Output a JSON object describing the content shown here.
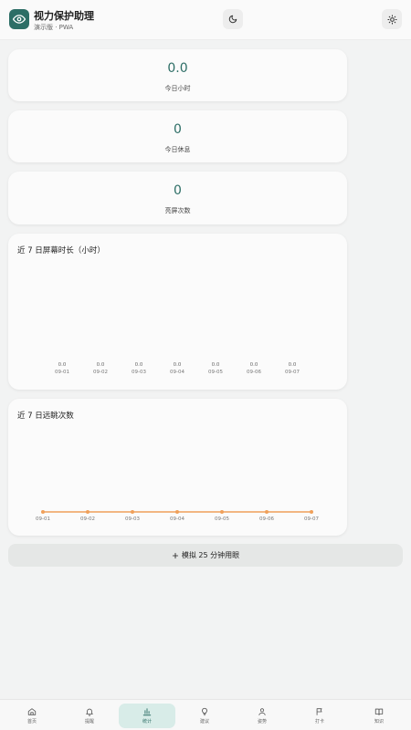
{
  "header": {
    "title": "视力保护助理",
    "subtitle": "演示版 · PWA"
  },
  "stats": [
    {
      "value": "0.0",
      "label": "今日小时"
    },
    {
      "value": "0",
      "label": "今日休息"
    },
    {
      "value": "0",
      "label": "亮屏次数"
    }
  ],
  "charts": {
    "screen_time": {
      "title": "近 7 日屏幕时长（小时）"
    },
    "breaks": {
      "title": "近 7 日远眺次数"
    }
  },
  "chart_data": [
    {
      "type": "bar",
      "title": "近 7 日屏幕时长（小时）",
      "categories": [
        "09-01",
        "09-02",
        "09-03",
        "09-04",
        "09-05",
        "09-06",
        "09-07"
      ],
      "values": [
        0.0,
        0.0,
        0.0,
        0.0,
        0.0,
        0.0,
        0.0
      ],
      "value_labels": [
        "0.0",
        "0.0",
        "0.0",
        "0.0",
        "0.0",
        "0.0",
        "0.0"
      ],
      "color": "#2d6e66"
    },
    {
      "type": "line",
      "title": "近 7 日远眺次数",
      "categories": [
        "09-01",
        "09-02",
        "09-03",
        "09-04",
        "09-05",
        "09-06",
        "09-07"
      ],
      "values": [
        0,
        0,
        0,
        0,
        0,
        0,
        0
      ],
      "color": "#f0a05a"
    }
  ],
  "actions": {
    "simulate_label": "模拟 25 分钟用眼"
  },
  "nav": {
    "active_index": 2,
    "items": [
      {
        "label": "首页",
        "icon": "home-icon"
      },
      {
        "label": "提醒",
        "icon": "bell-icon"
      },
      {
        "label": "统计",
        "icon": "bar-chart-icon"
      },
      {
        "label": "建议",
        "icon": "lightbulb-icon"
      },
      {
        "label": "姿势",
        "icon": "person-icon"
      },
      {
        "label": "打卡",
        "icon": "flag-icon"
      },
      {
        "label": "知识",
        "icon": "book-icon"
      }
    ]
  },
  "colors": {
    "accent": "#2d6e66",
    "line": "#f0a05a",
    "active_nav_bg": "#d8ece8"
  }
}
